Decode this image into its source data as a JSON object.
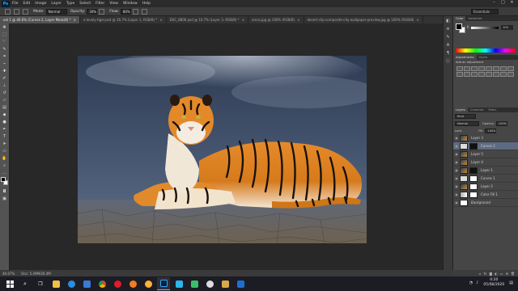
{
  "menubar": {
    "app_icon": "Ps",
    "items": [
      "File",
      "Edit",
      "Image",
      "Layer",
      "Type",
      "Select",
      "Filter",
      "View",
      "Window",
      "Help"
    ]
  },
  "options": {
    "mode_label": "Mode:",
    "mode_value": "Normal",
    "opacity_label": "Opacity:",
    "opacity_value": "30%",
    "flow_label": "Flow:",
    "flow_value": "80%",
    "workspace": "Essentials"
  },
  "tabs": [
    {
      "label": "ool 1 @ 46.6% (Curves 2, Layer Mask/8) *",
      "active": true
    },
    {
      "label": "x-lovely-tiger.psd @ 16.7% (Layer 1, RGB/8) *",
      "active": false
    },
    {
      "label": "DSC_8806.psd @ 16.7% (Layer 3, RGB/8) *",
      "active": false
    },
    {
      "label": "arcos.jpg @ 100% (RGB/8)",
      "active": false
    },
    {
      "label": "desert-clip-composite-city-wallpaper-preview.jpg @ 100% (RGB/8)",
      "active": false
    }
  ],
  "status": {
    "zoom": "46.67%",
    "doc": "Doc: 5.49M/26.4M"
  },
  "panels": {
    "color_tabs": [
      "Color",
      "Swatches"
    ],
    "k_label": "K",
    "k_value": "100",
    "adj_tabs": [
      "Adjustments",
      "Styles"
    ],
    "adj_head": "Add an adjustment",
    "layers_tabs": [
      "Layers",
      "Channels",
      "Paths"
    ],
    "kind_label": "Kind",
    "blend_mode": "Normal",
    "opacity_label": "Opacity:",
    "opacity_value": "100%",
    "lock_label": "Lock:",
    "fill_label": "Fill:",
    "fill_value": "100%"
  },
  "layers": [
    {
      "name": "Layer 3",
      "thumb": "img",
      "mask": false,
      "selected": false
    },
    {
      "name": "Curves 2",
      "thumb": "adj",
      "mask": true,
      "selected": true
    },
    {
      "name": "Layer 5",
      "thumb": "img",
      "mask": false,
      "selected": false
    },
    {
      "name": "Layer 4",
      "thumb": "img",
      "mask": false,
      "selected": false
    },
    {
      "name": "Layer 1",
      "thumb": "img",
      "mask": true,
      "selected": false
    },
    {
      "name": "Curves 1",
      "thumb": "adj",
      "mask": true,
      "selected": false
    },
    {
      "name": "Layer 2",
      "thumb": "img",
      "mask": true,
      "selected": false
    },
    {
      "name": "Color Fill 1",
      "thumb": "grey",
      "mask": true,
      "selected": false
    },
    {
      "name": "Background",
      "thumb": "grey",
      "mask": false,
      "selected": false,
      "italic": true
    }
  ],
  "tray": {
    "time": "0:20",
    "date": "05/08/2020"
  },
  "taskbar_apps": [
    "file-explorer",
    "edge",
    "store",
    "chrome",
    "opera",
    "firefox",
    "photos",
    "photoshop",
    "app-blue",
    "app-green",
    "clock-app",
    "app-folder",
    "app-terminal"
  ]
}
